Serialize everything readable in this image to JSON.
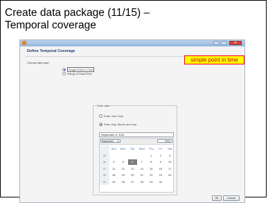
{
  "slide": {
    "title_line1": "Create data package (11/15) –",
    "title_line2": "Temporal coverage",
    "callout": "simple point in time"
  },
  "window": {
    "heading": "Define Temporal Coverage",
    "choose_label": "Choose date type:",
    "options": [
      {
        "label": "Single Point in Time",
        "selected": true
      },
      {
        "label": "Range of Date/Time",
        "selected": false
      }
    ],
    "date_panel": {
      "legend": "Enter date",
      "options": [
        {
          "label": "Enter Year Only",
          "selected": false
        },
        {
          "label": "Enter Day, Month and Year",
          "selected": true
        }
      ],
      "date_value": "September 6, 2011",
      "month": "September",
      "year": "2011",
      "weekdays": [
        "",
        "Sun",
        "Mon",
        "Tue",
        "Wed",
        "Thu",
        "Fri",
        "Sat"
      ],
      "weeks": [
        [
          "35",
          "",
          "",
          "",
          "",
          "1",
          "2",
          "3"
        ],
        [
          "36",
          "4",
          "5",
          "6",
          "7",
          "8",
          "9",
          "10"
        ],
        [
          "37",
          "11",
          "12",
          "13",
          "14",
          "15",
          "16",
          "17"
        ],
        [
          "38",
          "18",
          "19",
          "20",
          "21",
          "22",
          "23",
          "24"
        ],
        [
          "39",
          "25",
          "26",
          "27",
          "28",
          "29",
          "30",
          ""
        ]
      ],
      "selected_day": "6"
    },
    "buttons": {
      "ok": "OK",
      "cancel": "Cancel"
    }
  }
}
